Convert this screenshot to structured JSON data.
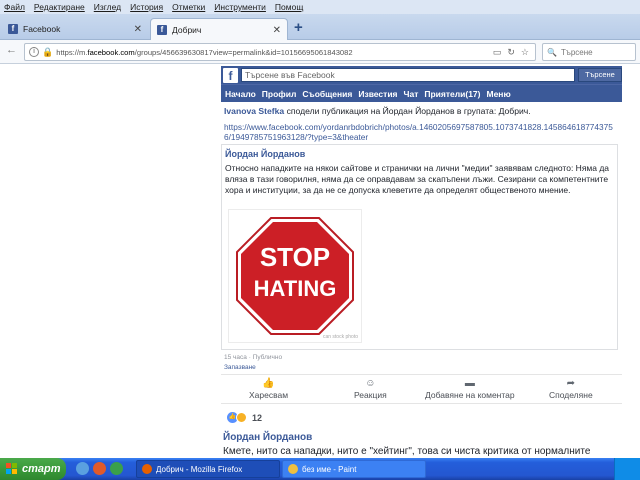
{
  "browser": {
    "menu": [
      "Файл",
      "Редактиране",
      "Изглед",
      "История",
      "Отметки",
      "Инструменти",
      "Помощ"
    ],
    "tabs": [
      {
        "label": "Facebook",
        "active": false
      },
      {
        "label": "Добрич",
        "active": true
      }
    ],
    "new_tab": "+",
    "url_prefix": "https://m.",
    "url_domain": "facebook.com",
    "url_rest": "/groups/456639630817view=permalink&id=10156695061843082",
    "search_placeholder": "Търсене"
  },
  "fb": {
    "logo": "f",
    "search_placeholder": "Търсене във Facebook",
    "search_button": "Търсене",
    "nav": [
      "Начало",
      "Профил",
      "Съобщения",
      "Известия",
      "Чат",
      "Приятели(17)",
      "Меню"
    ]
  },
  "share": {
    "name": "Ivanova Stefka",
    "text": " сподели публикация на Йордан Йорданов в групата: Добрич."
  },
  "link": "https://www.facebook.com/yordanrbdobrich/photos/a.1460205697587805.1073741828.1458646187743756/1949785751963128/?type=3&theater",
  "post": {
    "author": "Йордан Йорданов",
    "text": "Относно нападките на някои сайтове и странички на лични \"медии\" заявявам следното: Няма да вляза в тази говорилня, няма да се оправдавам за скапъпени лъжи. Сезирани са компетентните хора и институции, за да не се допуска клеветите да определят общественото мнение.",
    "image_text_1": "STOP",
    "image_text_2": "HATING",
    "watermark": "can stock photo",
    "time": "15 часа · Публично",
    "save": "Запазване"
  },
  "actions": [
    {
      "label": "Харесвам",
      "icon": "thumbs-up-icon"
    },
    {
      "label": "Реакция",
      "icon": "smiley-icon"
    },
    {
      "label": "Добавяне на коментар",
      "icon": "comment-icon"
    },
    {
      "label": "Споделяне",
      "icon": "share-icon"
    }
  ],
  "reactions_count": "12",
  "comment": {
    "author": "Йордан Йорданов",
    "text": "Кмете, нито са нападки, нито е \"хейтинг\", това си чиста критика от нормалните"
  },
  "taskbar": {
    "start": "старт",
    "tasks": [
      {
        "label": "Добрич - Mozilla Firefox",
        "active": true
      },
      {
        "label": "без име - Paint",
        "active": false
      }
    ]
  },
  "colors": {
    "fb_blue": "#3b5998",
    "stop_red": "#cc1f26",
    "xp_blue": "#245edb",
    "xp_green": "#3a9a3a"
  }
}
